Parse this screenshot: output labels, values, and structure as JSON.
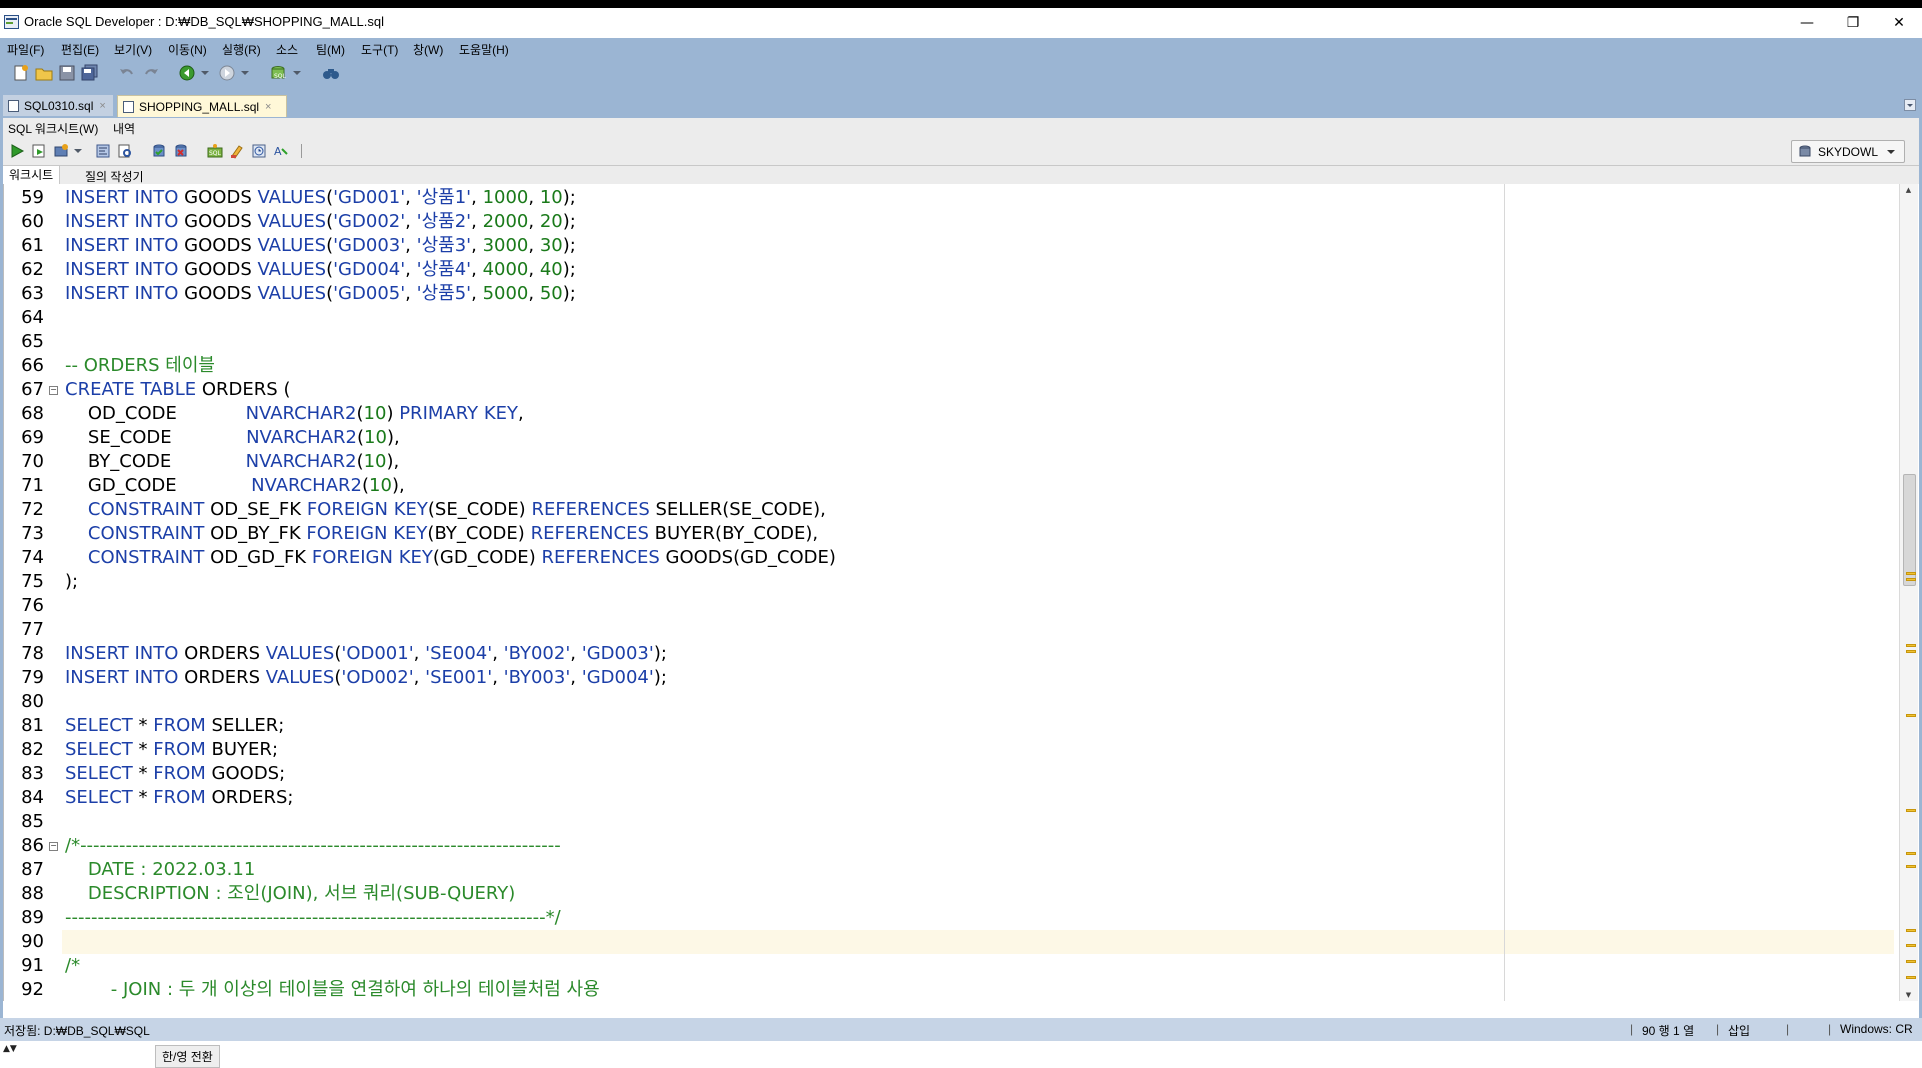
{
  "window": {
    "title": "Oracle SQL Developer : D:₩DB_SQL₩SHOPPING_MALL.sql",
    "minimize_glyph": "—",
    "restore_glyph": "❐",
    "close_glyph": "✕"
  },
  "menubar": {
    "items": [
      "파일(F)",
      "편집(E)",
      "보기(V)",
      "이동(N)",
      "실행(R)",
      "소스",
      "팀(M)",
      "도구(T)",
      "창(W)",
      "도움말(H)"
    ]
  },
  "tabs": [
    {
      "label": "SQL0310.sql",
      "close": "×"
    },
    {
      "label": "SHOPPING_MALL.sql",
      "close": "×"
    }
  ],
  "worksheet_bar": {
    "label": "SQL 워크시트(W)",
    "history": "내역"
  },
  "connection": {
    "name": "SKYDOWL",
    "icon": "database-connection-icon"
  },
  "editor_tabs": [
    "워크시트",
    "질의 작성기"
  ],
  "code_lines": [
    {
      "n": "59",
      "t": "INSERT INTO GOODS VALUES('GD001', '상품1', 1000, 10);"
    },
    {
      "n": "60",
      "t": "INSERT INTO GOODS VALUES('GD002', '상품2', 2000, 20);"
    },
    {
      "n": "61",
      "t": "INSERT INTO GOODS VALUES('GD003', '상품3', 3000, 30);"
    },
    {
      "n": "62",
      "t": "INSERT INTO GOODS VALUES('GD004', '상품4', 4000, 40);"
    },
    {
      "n": "63",
      "t": "INSERT INTO GOODS VALUES('GD005', '상품5', 5000, 50);"
    },
    {
      "n": "64",
      "t": ""
    },
    {
      "n": "65",
      "t": ""
    },
    {
      "n": "66",
      "t": "-- ORDERS 테이블"
    },
    {
      "n": "67",
      "t": "CREATE TABLE ORDERS ("
    },
    {
      "n": "68",
      "t": "    OD_CODE            NVARCHAR2(10) PRIMARY KEY,"
    },
    {
      "n": "69",
      "t": "    SE_CODE             NVARCHAR2(10),"
    },
    {
      "n": "70",
      "t": "    BY_CODE             NVARCHAR2(10),"
    },
    {
      "n": "71",
      "t": "    GD_CODE             NVARCHAR2(10),"
    },
    {
      "n": "72",
      "t": "    CONSTRAINT OD_SE_FK FOREIGN KEY(SE_CODE) REFERENCES SELLER(SE_CODE),"
    },
    {
      "n": "73",
      "t": "    CONSTRAINT OD_BY_FK FOREIGN KEY(BY_CODE) REFERENCES BUYER(BY_CODE),"
    },
    {
      "n": "74",
      "t": "    CONSTRAINT OD_GD_FK FOREIGN KEY(GD_CODE) REFERENCES GOODS(GD_CODE)"
    },
    {
      "n": "75",
      "t": ");"
    },
    {
      "n": "76",
      "t": ""
    },
    {
      "n": "77",
      "t": ""
    },
    {
      "n": "78",
      "t": "INSERT INTO ORDERS VALUES('OD001', 'SE004', 'BY002', 'GD003');"
    },
    {
      "n": "79",
      "t": "INSERT INTO ORDERS VALUES('OD002', 'SE001', 'BY003', 'GD004');"
    },
    {
      "n": "80",
      "t": ""
    },
    {
      "n": "81",
      "t": "SELECT * FROM SELLER;"
    },
    {
      "n": "82",
      "t": "SELECT * FROM BUYER;"
    },
    {
      "n": "83",
      "t": "SELECT * FROM GOODS;"
    },
    {
      "n": "84",
      "t": "SELECT * FROM ORDERS;"
    },
    {
      "n": "85",
      "t": ""
    },
    {
      "n": "86",
      "t": "/*--------------------------------------------------------------------------"
    },
    {
      "n": "87",
      "t": "    DATE : 2022.03.11"
    },
    {
      "n": "88",
      "t": "    DESCRIPTION : 조인(JOIN), 서브 쿼리(SUB-QUERY)"
    },
    {
      "n": "89",
      "t": "--------------------------------------------------------------------------*/"
    },
    {
      "n": "90",
      "t": ""
    },
    {
      "n": "91",
      "t": "/*"
    },
    {
      "n": "92",
      "t": "        - JOIN : 두 개 이상의 테이블을 연결하여 하나의 테이블처럼 사용"
    }
  ],
  "statusbar": {
    "saved": "저장됨: D:₩DB_SQL₩SQL",
    "ime": "한/영 전환",
    "position": "90 행 1 열",
    "mode": "삽입",
    "line_endings": "Windows: CR"
  },
  "colors": {
    "keyword": "#1c3fa8",
    "number": "#1a7a1a",
    "comment": "#2b8a2b",
    "ide_background": "#9bb5d3",
    "current_line": "#fdf8e6"
  }
}
